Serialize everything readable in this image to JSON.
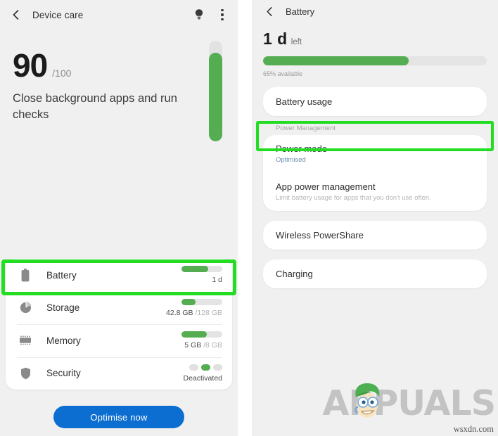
{
  "left_panel": {
    "topbar": {
      "back_icon": "back-chevron-icon",
      "title": "Device care",
      "tips_icon": "lightbulb-icon",
      "overflow_icon": "overflow-menu-icon"
    },
    "score": {
      "value": "90",
      "denominator": "/100",
      "description": "Close background apps and run checks",
      "gauge_percent": 88
    },
    "rows": [
      {
        "icon": "battery-icon",
        "label": "Battery",
        "bar_percent": 65,
        "value": "1 d",
        "value_muted": "",
        "type": "bar",
        "highlighted": true
      },
      {
        "icon": "storage-pie-icon",
        "label": "Storage",
        "bar_percent": 34,
        "value": "42.8 GB",
        "value_muted": "/128 GB",
        "type": "bar",
        "highlighted": false
      },
      {
        "icon": "memory-chip-icon",
        "label": "Memory",
        "bar_percent": 62,
        "value": "5 GB",
        "value_muted": "/8 GB",
        "type": "bar",
        "highlighted": false
      },
      {
        "icon": "shield-icon",
        "label": "Security",
        "value": "Deactivated",
        "value_muted": "",
        "type": "dots",
        "dots_active_index": 1,
        "highlighted": false
      }
    ],
    "optimise_button": "Optimise now"
  },
  "right_panel": {
    "topbar": {
      "back_icon": "back-chevron-icon",
      "title": "Battery"
    },
    "summary": {
      "time_value": "1 d",
      "time_unit": "left",
      "bar_percent": 65,
      "caption": "65% available"
    },
    "cards": [
      {
        "items": [
          {
            "title": "Battery usage",
            "subtitle": "",
            "subtitle_style": "none"
          }
        ]
      },
      {
        "section_label": "Power Management",
        "items": [
          {
            "title": "Power mode",
            "subtitle": "Optimised",
            "subtitle_style": "blue",
            "highlighted": true
          },
          {
            "title": "App power management",
            "subtitle": "Limit battery usage for apps that you don't use often.",
            "subtitle_style": "grey"
          }
        ]
      },
      {
        "items": [
          {
            "title": "Wireless PowerShare",
            "subtitle": "",
            "subtitle_style": "none"
          }
        ]
      },
      {
        "items": [
          {
            "title": "Charging",
            "subtitle": "",
            "subtitle_style": "none"
          }
        ]
      }
    ]
  },
  "watermark": {
    "brand": "APPUALS",
    "site": "wsxdn.com",
    "mascot_icon": "appuals-mascot-icon"
  },
  "colors": {
    "accent_green": "#55ad51",
    "highlight_green": "#22dd22",
    "button_blue": "#0d6ed2",
    "panel_bg": "#f0f0f0",
    "card_bg": "#ffffff"
  }
}
